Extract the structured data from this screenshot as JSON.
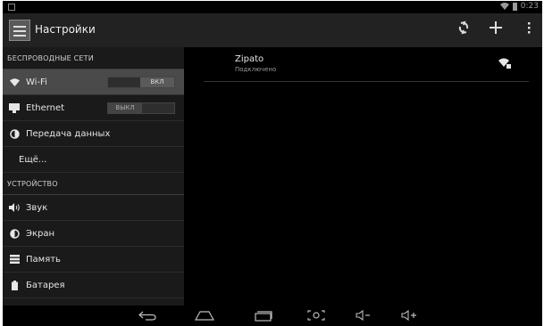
{
  "status_bar": {
    "time": "0:23"
  },
  "action_bar": {
    "title": "Настройки"
  },
  "sidebar": {
    "sections": [
      {
        "header": "БЕСПРОВОДНЫЕ СЕТИ",
        "items": [
          {
            "label": "Wi-Fi",
            "toggle": "ВКЛ"
          },
          {
            "label": "Ethernet",
            "toggle": "ВЫКЛ"
          },
          {
            "label": "Передача данных"
          },
          {
            "label": "Ещё..."
          }
        ]
      },
      {
        "header": "УСТРОЙСТВО",
        "items": [
          {
            "label": "Звук"
          },
          {
            "label": "Экран"
          },
          {
            "label": "Память"
          },
          {
            "label": "Батарея"
          }
        ]
      }
    ]
  },
  "network": {
    "name": "Zipato",
    "status": "Подключено"
  }
}
